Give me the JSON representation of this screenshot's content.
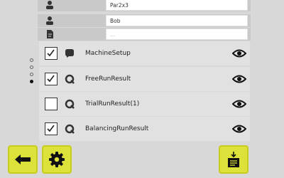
{
  "user_info": {
    "top_field_value": "Par2x3",
    "username_value": "Bob",
    "third_field_placeholder": "..."
  },
  "pager": {
    "total_pages": 4,
    "active_page": 4
  },
  "result_rows": [
    {
      "label": "MachineSetup",
      "checked": true,
      "type_icon": "chat-bubble-icon"
    },
    {
      "label": "FreeRunResult",
      "checked": true,
      "type_icon": "rotation-icon"
    },
    {
      "label": "TrialRunResult(1)",
      "checked": false,
      "type_icon": "rotation-icon"
    },
    {
      "label": "BalancingRunResult",
      "checked": true,
      "type_icon": "rotation-icon"
    }
  ],
  "toolbar": {
    "back_icon": "arrow-left-icon",
    "settings_icon": "gear-icon",
    "export_icon": "download-document-icon"
  },
  "colors": {
    "accent_button": "#dde23a",
    "row_background": "#e1e1e1",
    "page_background": "#d8d8d8"
  }
}
